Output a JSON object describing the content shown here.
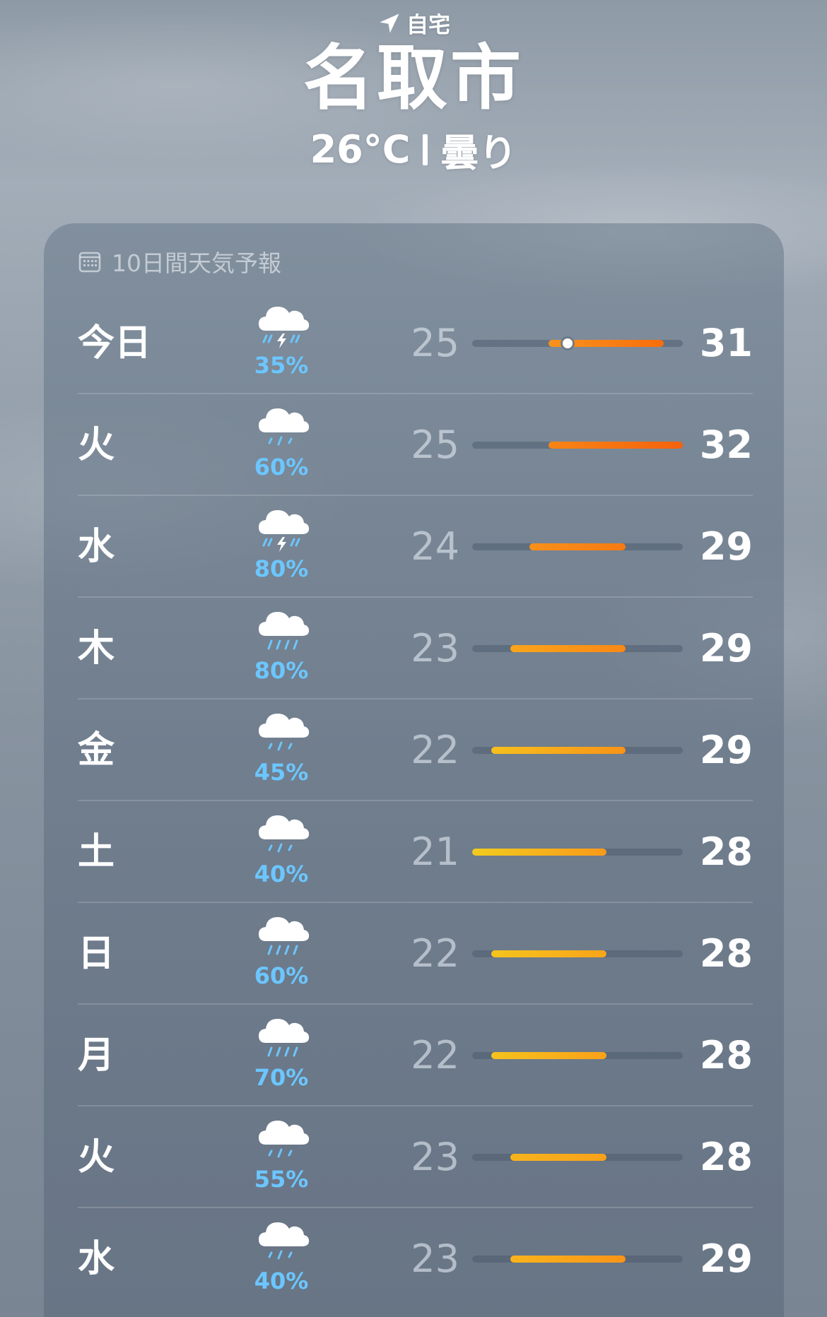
{
  "header": {
    "location_label": "自宅",
    "city": "名取市",
    "temperature": "26°C",
    "condition": "曇り"
  },
  "forecast": {
    "title": "10日間天気予報",
    "icon": "calendar-icon",
    "scale": {
      "min": 21,
      "max": 32
    },
    "current_temp": 26,
    "days": [
      {
        "day": "今日",
        "icon": "thunderstorm-icon",
        "pop": "35%",
        "low": "25",
        "high": "31",
        "low_val": 25,
        "high_val": 31,
        "c1": "#f7931e",
        "c2": "#f86d0c",
        "current": true
      },
      {
        "day": "火",
        "icon": "rain-icon",
        "pop": "60%",
        "low": "25",
        "high": "32",
        "low_val": 25,
        "high_val": 32,
        "c1": "#f78416",
        "c2": "#f5620d"
      },
      {
        "day": "水",
        "icon": "thunderstorm-icon",
        "pop": "80%",
        "low": "24",
        "high": "29",
        "low_val": 24,
        "high_val": 29,
        "c1": "#f8901a",
        "c2": "#f77a12"
      },
      {
        "day": "木",
        "icon": "heavy-rain-icon",
        "pop": "80%",
        "low": "23",
        "high": "29",
        "low_val": 23,
        "high_val": 29,
        "c1": "#f9a51b",
        "c2": "#f88816"
      },
      {
        "day": "金",
        "icon": "rain-icon",
        "pop": "45%",
        "low": "22",
        "high": "29",
        "low_val": 22,
        "high_val": 29,
        "c1": "#f6c01d",
        "c2": "#f99318"
      },
      {
        "day": "土",
        "icon": "rain-icon",
        "pop": "40%",
        "low": "21",
        "high": "28",
        "low_val": 21,
        "high_val": 28,
        "c1": "#f2cc1f",
        "c2": "#f99a1a"
      },
      {
        "day": "日",
        "icon": "heavy-rain-icon",
        "pop": "60%",
        "low": "22",
        "high": "28",
        "low_val": 22,
        "high_val": 28,
        "c1": "#f6c41d",
        "c2": "#f9a519"
      },
      {
        "day": "月",
        "icon": "heavy-rain-icon",
        "pop": "70%",
        "low": "22",
        "high": "28",
        "low_val": 22,
        "high_val": 28,
        "c1": "#f6c21d",
        "c2": "#f9a119"
      },
      {
        "day": "火",
        "icon": "rain-icon",
        "pop": "55%",
        "low": "23",
        "high": "28",
        "low_val": 23,
        "high_val": 28,
        "c1": "#f8b41c",
        "c2": "#f9a119"
      },
      {
        "day": "水",
        "icon": "rain-icon",
        "pop": "40%",
        "low": "23",
        "high": "29",
        "low_val": 23,
        "high_val": 29,
        "c1": "#f8b41c",
        "c2": "#f99418"
      }
    ]
  }
}
